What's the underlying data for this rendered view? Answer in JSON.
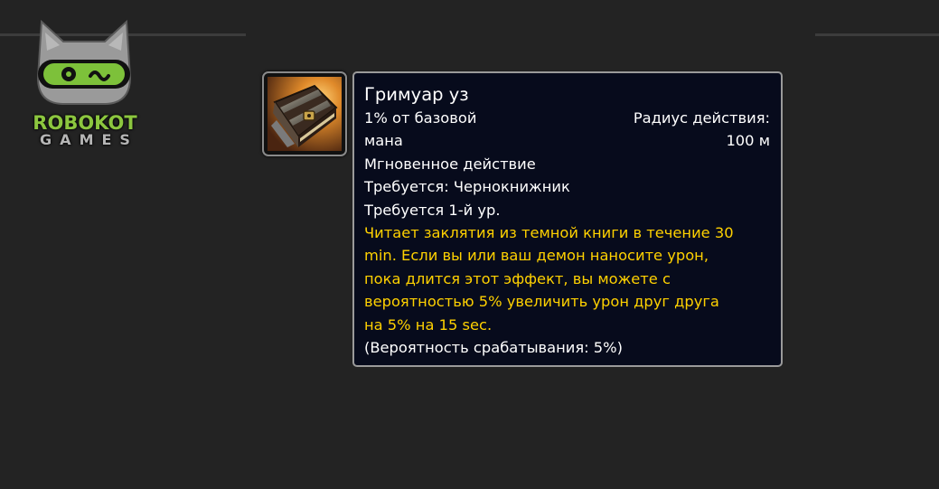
{
  "logo": {
    "line1": "ROBOKOT",
    "line2": "GAMES",
    "colors": {
      "green": "#8cc63f",
      "gray": "#b5b5b5"
    }
  },
  "spell": {
    "icon": "grimoire-book-icon",
    "title": "Гримуар уз",
    "cost_lines": [
      "1% от базовой",
      "мана"
    ],
    "range_lines": [
      "Радиус действия:",
      "100 м"
    ],
    "cast_time": "Мгновенное действие",
    "requires_class": "Требуется: Чернокнижник",
    "requires_level": "Требуется 1-й ур.",
    "description_lines": [
      "Читает заклятия из темной книги в течение 30",
      "min. Если вы или ваш демон наносите урон,",
      "пока длится этот эффект, вы можете с",
      "вероятностью 5% увеличить урон друг друга",
      "на 5% на 15 sec."
    ],
    "proc_chance": "(Вероятность срабатывания: 5%)",
    "colors": {
      "tooltip_bg": "#070b1c",
      "description": "#ffd100",
      "text": "#ffffff"
    }
  }
}
